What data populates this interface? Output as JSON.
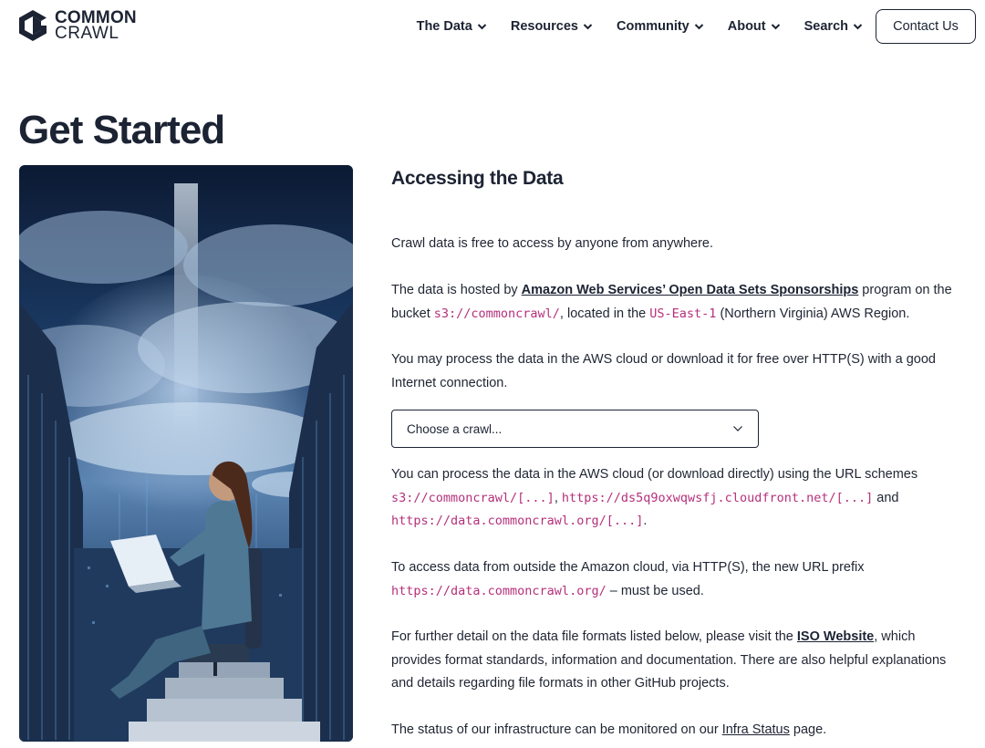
{
  "brand": {
    "line1": "COMMON",
    "line2": "CRAWL",
    "color": "#1c2333"
  },
  "nav": {
    "items": [
      {
        "label": "The Data"
      },
      {
        "label": "Resources"
      },
      {
        "label": "Community"
      },
      {
        "label": "About"
      },
      {
        "label": "Search"
      }
    ],
    "contact_label": "Contact Us"
  },
  "page": {
    "title": "Get Started"
  },
  "section": {
    "title": "Accessing the Data"
  },
  "content": {
    "p1": "Crawl data is free to access by anyone from anywhere.",
    "p2": {
      "before": "The data is hosted by ",
      "link": "Amazon Web Services’ Open Data Sets Sponsorships",
      "middle": " program on the bucket ",
      "bucket": "s3://commoncrawl/",
      "middle2": ", located in the ",
      "region": "US-East-1",
      "after": " (Northern Virginia) AWS Region."
    },
    "p3": "You may process the data in the AWS cloud or download it for free over HTTP(S) with a good Internet connection.",
    "select": {
      "placeholder": "Choose a crawl..."
    },
    "p4": {
      "before": "You can process the data in the AWS cloud (or download directly) using the URL schemes ",
      "url1": "s3://commoncrawl/[...]",
      "sep": ", ",
      "url2": "https://ds5q9oxwqwsfj.cloudfront.net/[...]",
      "and": " and ",
      "url3": "https://data.commoncrawl.org/[...]",
      "end": "."
    },
    "p5": {
      "before": "To access data from outside the Amazon cloud, via HTTP(S), the new URL prefix ",
      "url": "https://data.commoncrawl.org/",
      "after": " – must be used."
    },
    "p6": {
      "before": "For further detail on the data file formats listed below, please visit the ",
      "link": "ISO Website",
      "after": ", which provides format standards, information and documentation. There are also helpful explanations and details regarding file formats in other GitHub projects."
    },
    "p7": {
      "before": "The status of our infrastructure can be monitored on our ",
      "link": "Infra Status",
      "after": " page."
    }
  },
  "colors": {
    "code": "#b5307b",
    "text": "#1f2533"
  }
}
